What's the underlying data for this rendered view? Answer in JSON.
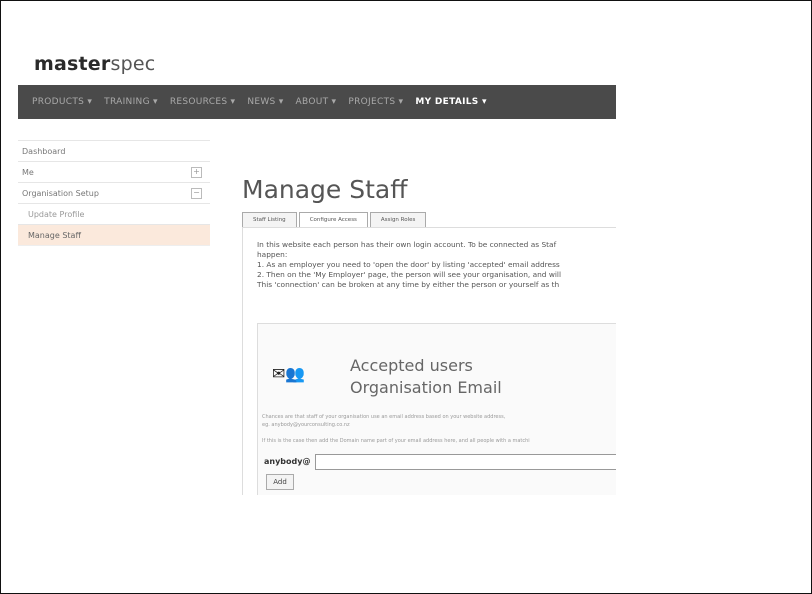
{
  "brand": {
    "bold": "master",
    "light": "spec"
  },
  "nav": {
    "items": [
      {
        "label": "PRODUCTS ▾",
        "active": false
      },
      {
        "label": "TRAINING ▾",
        "active": false
      },
      {
        "label": "RESOURCES ▾",
        "active": false
      },
      {
        "label": "NEWS ▾",
        "active": false
      },
      {
        "label": "ABOUT ▾",
        "active": false
      },
      {
        "label": "PROJECTS ▾",
        "active": false
      },
      {
        "label": "MY DETAILS ▾",
        "active": true
      }
    ]
  },
  "sidebar": {
    "items": [
      {
        "label": "Dashboard"
      },
      {
        "label": "Me",
        "expander": "+"
      },
      {
        "label": "Organisation Setup",
        "expander": "−"
      },
      {
        "label": "Update Profile"
      },
      {
        "label": "Manage Staff"
      }
    ]
  },
  "page": {
    "title": "Manage Staff"
  },
  "tabs": [
    {
      "label": "Staff Listing"
    },
    {
      "label": "Configure Access"
    },
    {
      "label": "Assign Roles"
    }
  ],
  "content": {
    "para": [
      "In this website each person has their own login account. To be connected as Staf",
      "happen:",
      "1. As an employer you need to 'open the door' by listing 'accepted' email address",
      "2. Then on the 'My Employer' page, the person will see your organisation, and will",
      "This 'connection' can be broken at any time by either the person or yourself as th"
    ]
  },
  "panel": {
    "title": "Accepted users",
    "subtitle": "Organisation Email",
    "note1": "Chances are that staff of your organisation use an email address based on your website address,",
    "note2": "eg. anybody@yourconsulting.co.nz",
    "note3": "If this is the case then add the Domain name part of your email address here, and all people with a matchi",
    "email_label": "anybody@",
    "email_value": "",
    "add_label": "Add",
    "icons": "✉👥"
  }
}
